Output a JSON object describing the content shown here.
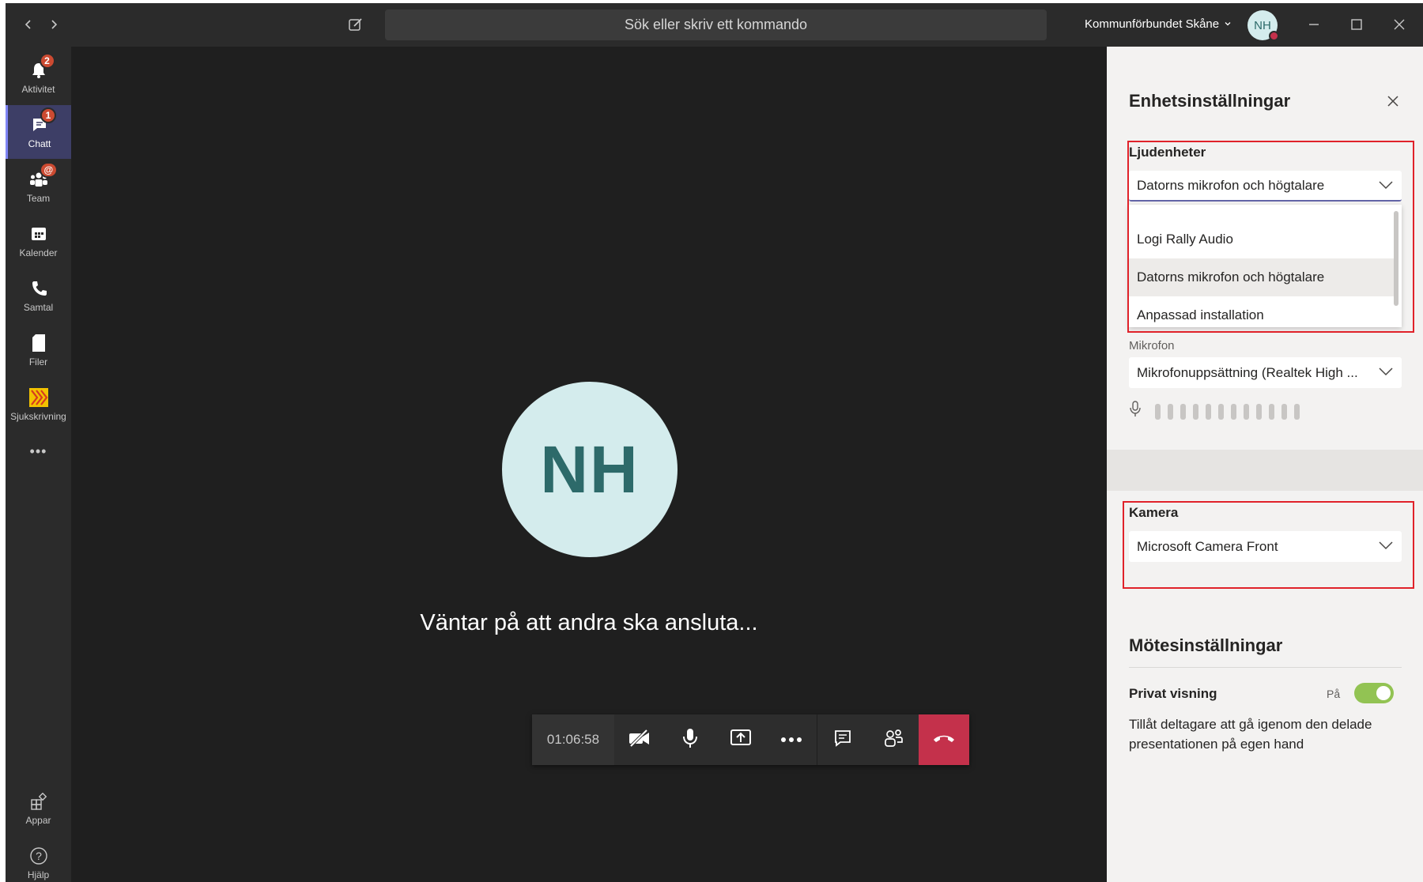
{
  "titlebar": {
    "search_placeholder": "Sök eller skriv ett kommando",
    "org_name": "Kommunförbundet Skåne",
    "user_initials": "NH"
  },
  "rail": {
    "items": [
      {
        "label": "Aktivitet",
        "icon": "bell-icon",
        "badge": "2"
      },
      {
        "label": "Chatt",
        "icon": "chat-icon",
        "badge": "1"
      },
      {
        "label": "Team",
        "icon": "teams-icon",
        "badge": "@"
      },
      {
        "label": "Kalender",
        "icon": "calendar-icon",
        "badge": ""
      },
      {
        "label": "Samtal",
        "icon": "phone-icon",
        "badge": ""
      },
      {
        "label": "Filer",
        "icon": "file-icon",
        "badge": ""
      },
      {
        "label": "Sjukskrivning",
        "icon": "app-logo-icon",
        "badge": ""
      }
    ],
    "more": "•••",
    "bottom": [
      {
        "label": "Appar",
        "icon": "apps-icon"
      },
      {
        "label": "Hjälp",
        "icon": "help-icon"
      }
    ]
  },
  "stage": {
    "participant_initials": "NH",
    "waiting_text": "Väntar på att andra ska ansluta...",
    "timer": "01:06:58"
  },
  "panel": {
    "title": "Enhetsinställningar",
    "audio": {
      "label": "Ljudenheter",
      "selected": "Datorns mikrofon och högtalare",
      "options": [
        "Logi Rally Audio",
        "Datorns mikrofon och högtalare",
        "Anpassad installation"
      ]
    },
    "microphone": {
      "label": "Mikrofon",
      "selected": "Mikrofonuppsättning (Realtek High ..."
    },
    "camera": {
      "label": "Kamera",
      "selected": "Microsoft Camera Front"
    },
    "meeting": {
      "title": "Mötesinställningar",
      "private_view_label": "Privat visning",
      "private_view_state": "På",
      "private_view_on": true,
      "description": "Tillåt deltagare att gå igenom den delade presentationen på egen hand"
    }
  },
  "colors": {
    "accent": "#6264a7",
    "hangup": "#c4314b",
    "badge": "#cc4a31",
    "toggle_on": "#92c353",
    "highlight_box": "#e0222a"
  }
}
